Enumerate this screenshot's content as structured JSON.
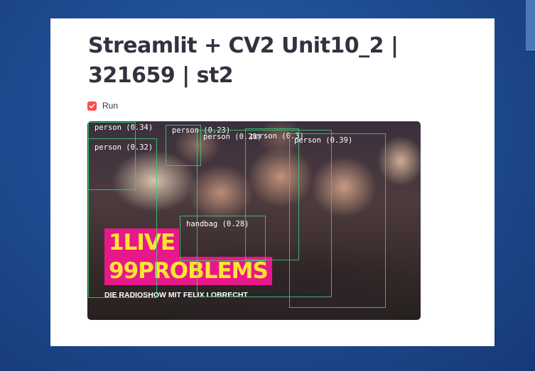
{
  "page": {
    "title": "Streamlit + CV2 Unit10_2 | 321659 | st2"
  },
  "controls": {
    "run_label": "Run",
    "run_checked": true,
    "accent_color": "#ff4b4b"
  },
  "video": {
    "banner_line1": "1LIVE",
    "banner_line2": "99PROBLEMS",
    "banner_subtitle": "DIE RADIOSHOW MIT FELIX LOBRECHT",
    "detections": [
      {
        "label": "person (0.34)"
      },
      {
        "label": "person (0.32)"
      },
      {
        "label": "person (0.23)"
      },
      {
        "label": "person (0.21)"
      },
      {
        "label": "person (0.3)"
      },
      {
        "label": "person (0.39)"
      },
      {
        "label": "handbag (0.28)"
      }
    ]
  },
  "colors": {
    "detection_box": "#3ccd78",
    "banner_bg": "#e8178a",
    "banner_text": "#fbe632"
  }
}
